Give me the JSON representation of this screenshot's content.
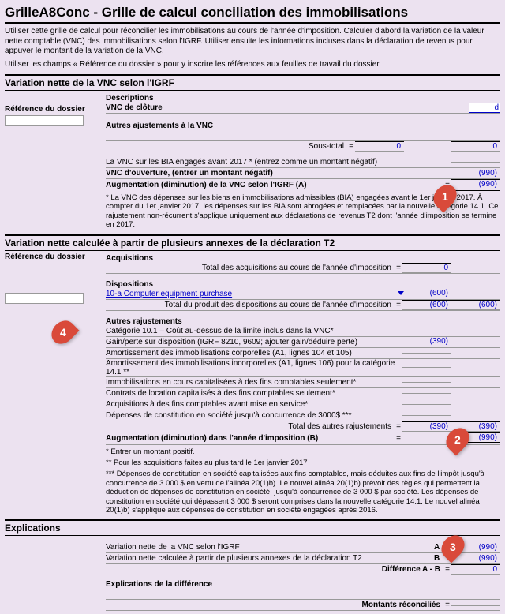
{
  "title": "GrilleA8Conc - Grille de calcul conciliation des immobilisations",
  "intro1": "Utiliser cette grille de calcul pour réconcilier les immobilisations au cours de l'année d'imposition. Calculer d'abord la variation de la valeur nette comptable (VNC) des immobilisations selon l'IGRF. Utiliser ensuite les informations incluses dans la déclaration de revenus pour appuyer le montant de la variation de la VNC.",
  "intro2": "Utiliser les champs « Référence du dossier » pour y inscrire les références aux feuilles de travail du dossier.",
  "ref_label": "Référence du dossier",
  "sec1": {
    "title": "Variation nette de la VNC selon l'IGRF",
    "descriptions": "Descriptions",
    "vnc_cloture": "VNC de clôture",
    "vnc_cloture_input": "d",
    "autres_ajust": "Autres ajustements à la VNC",
    "sous_total": "Sous-total",
    "sous_total_v1": "0",
    "sous_total_v2": "0",
    "bia_line": "La VNC sur les BIA engagés avant 2017 * (entrez comme un montant négatif)",
    "vnc_ouverture": "VNC d'ouverture, (entrer un montant négatif)",
    "vnc_ouverture_v": "(990)",
    "aug_a": "Augmentation (diminution) de la VNC selon l'IGRF (A)",
    "aug_a_v": "(990)",
    "note": "* La VNC des dépenses sur les biens en immobilisations admissibles (BIA) engagées avant le 1er janvier 2017. À compter du 1er janvier 2017, les dépenses sur les BIA sont abrogées et remplacées par la nouvelle catégorie 14.1. Ce rajustement non-récurrent s'applique uniquement aux déclarations de revenus T2 dont l'année d'imposition se termine en 2017."
  },
  "sec2": {
    "title": "Variation nette calculée à partir de plusieurs annexes de la déclaration T2",
    "acq_h": "Acquisitions",
    "acq_total": "Total des acquisitions au cours de l'année d'imposition",
    "acq_total_v": "0",
    "disp_h": "Dispositions",
    "disp_link": "10-a Computer equipment purchase",
    "disp_link_v": "(600)",
    "disp_total": "Total du produit des dispositions au cours de l'année d'imposition",
    "disp_total_v1": "(600)",
    "disp_total_v2": "(600)",
    "autres_h": "Autres rajustements",
    "lines": [
      {
        "d": "Catégorie 10.1 – Coût au-dessus de la limite inclus dans la VNC*",
        "v": ""
      },
      {
        "d": "Gain/perte sur disposition (IGRF 8210, 9609; ajouter gain/déduire perte)",
        "v": "(390)"
      },
      {
        "d": "Amortissement des immobilisations corporelles (A1, lignes 104 et 105)",
        "v": ""
      },
      {
        "d": "Amortissement des immobilisations incorporelles (A1, lignes 106) pour la catégorie 14.1 **",
        "v": ""
      },
      {
        "d": "Immobilisations en cours capitalisées à des fins comptables seulement*",
        "v": ""
      },
      {
        "d": "Contrats de location capitalisés à des fins comptables seulement*",
        "v": ""
      },
      {
        "d": "Acquisitions à des fins comptables avant mise en service*",
        "v": ""
      },
      {
        "d": "Dépenses de constitution en société jusqu'à concurrence de 3000$ ***",
        "v": ""
      }
    ],
    "autres_total": "Total des autres rajustements",
    "autres_total_v1": "(390)",
    "autres_total_v2": "(390)",
    "aug_b": "Augmentation (diminution) dans l'année d'imposition (B)",
    "aug_b_v": "(990)",
    "notes": [
      "* Entrer un montant positif.",
      "** Pour les acquisitions faites au plus tard le 1er janvier 2017",
      "*** Dépenses de constitution en société capitalisées aux fins comptables, mais déduites aux fins de l'impôt jusqu'à concurrence de 3 000 $ en vertu de l'alinéa 20(1)b). Le nouvel alinéa 20(1)b) prévoit des règles qui permettent la déduction de dépenses de constitution en société, jusqu'à concurrence de 3 000 $ par société. Les dépenses de constitution en société qui dépassent 3 000 $ seront comprises dans la nouvelle catégorie 14.1. Le nouvel alinéa 20(1)b) s'applique aux dépenses de constitution en société engagées après 2016."
    ]
  },
  "sec3": {
    "title": "Explications",
    "rowA": "Variation nette de la VNC selon l'IGRF",
    "rowA_l": "A",
    "rowA_v": "(990)",
    "rowB": "Variation nette calculée à partir de plusieurs annexes de la déclaration T2",
    "rowB_l": "B",
    "rowB_v": "(990)",
    "diff": "Différence A - B",
    "diff_v": "0",
    "expl": "Explications de la différence",
    "reconc": "Montants réconciliés"
  },
  "callouts": {
    "c1": "1",
    "c2": "2",
    "c3": "3",
    "c4": "4"
  }
}
